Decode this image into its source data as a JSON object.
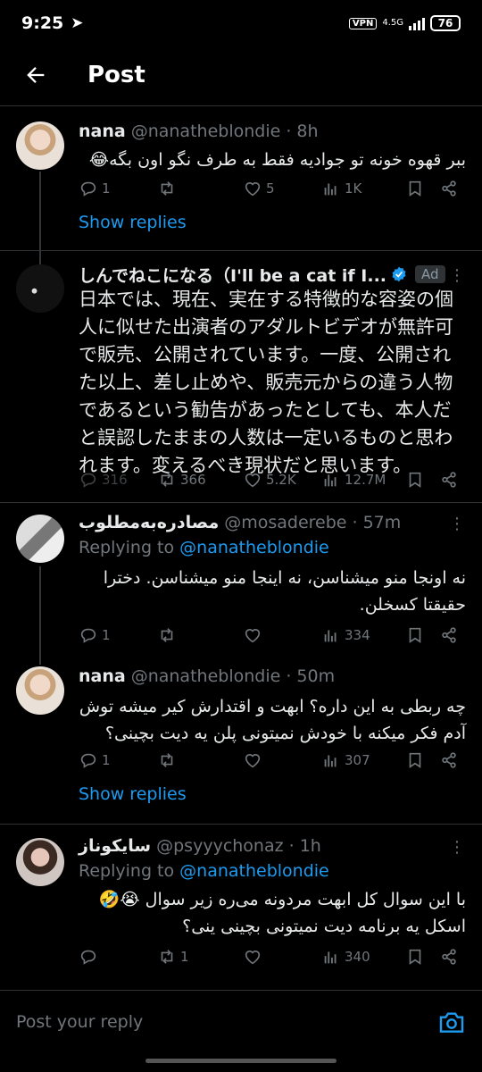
{
  "status_bar": {
    "time": "9:25",
    "vpn": "VPN",
    "network": "4.5G",
    "battery": "76"
  },
  "header": {
    "title": "Post"
  },
  "tweets": [
    {
      "name": "nana",
      "handle": "@nanatheblondie · 8h",
      "text": "ببر قهوه خونه تو جوادیه فقط به طرف نگو اون بگه😂",
      "replies": "1",
      "reposts": "",
      "likes": "5",
      "views": "1K",
      "show_replies": "Show replies"
    },
    {
      "name": "しんでねこになる（I'll be a cat if I...",
      "ad_label": "Ad",
      "text": "日本では、現在、実在する特徴的な容姿の個人に似せた出演者のアダルトビデオが無許可で販売、公開されています。一度、公開された以上、差し止めや、販売元からの違う人物であるという勧告があったとしても、本人だと誤認したままの人数は一定いるものと思われます。変えるべき現状だと思います。",
      "replies": "316",
      "reposts": "366",
      "likes": "5.2K",
      "views": "12.7M"
    },
    {
      "name": "مصادره‌به‌مطلوب",
      "handle": "@mosaderebe · 57m",
      "replying_prefix": "Replying to ",
      "replying_to": "@nanatheblondie",
      "text": "نه اونجا منو میشناسن، نه اینجا منو میشناسن. دخترا حقیقتا کسخلن.",
      "replies": "1",
      "reposts": "",
      "likes": "",
      "views": "334"
    },
    {
      "name": "nana",
      "handle": "@nanatheblondie · 50m",
      "text": "چه ربطی به این داره؟ ابهت و اقتدارش کیر میشه توش آدم فکر میکنه با خودش نمیتونی پلن یه دیت بچینی؟",
      "replies": "1",
      "reposts": "",
      "likes": "",
      "views": "307",
      "show_replies": "Show replies"
    },
    {
      "name": "سایکوناز",
      "handle": "@psyyychonaz · 1h",
      "replying_prefix": "Replying to ",
      "replying_to": "@nanatheblondie",
      "text": "با این سوال کل ابهت مردونه می‌ره زیر سوال 😭🤣 اسکل یه برنامه دیت نمیتونی بچینی ینی؟",
      "replies": "",
      "reposts": "1",
      "likes": "",
      "views": "340"
    }
  ],
  "reply_bar": {
    "placeholder": "Post your reply"
  },
  "colors": {
    "accent": "#1d9bf0",
    "muted": "#71767b",
    "background": "#000000"
  },
  "icons": [
    "back-arrow-icon",
    "reply-icon",
    "repost-icon",
    "like-icon",
    "views-icon",
    "bookmark-icon",
    "share-icon",
    "verified-icon",
    "camera-icon",
    "telegram-icon"
  ]
}
